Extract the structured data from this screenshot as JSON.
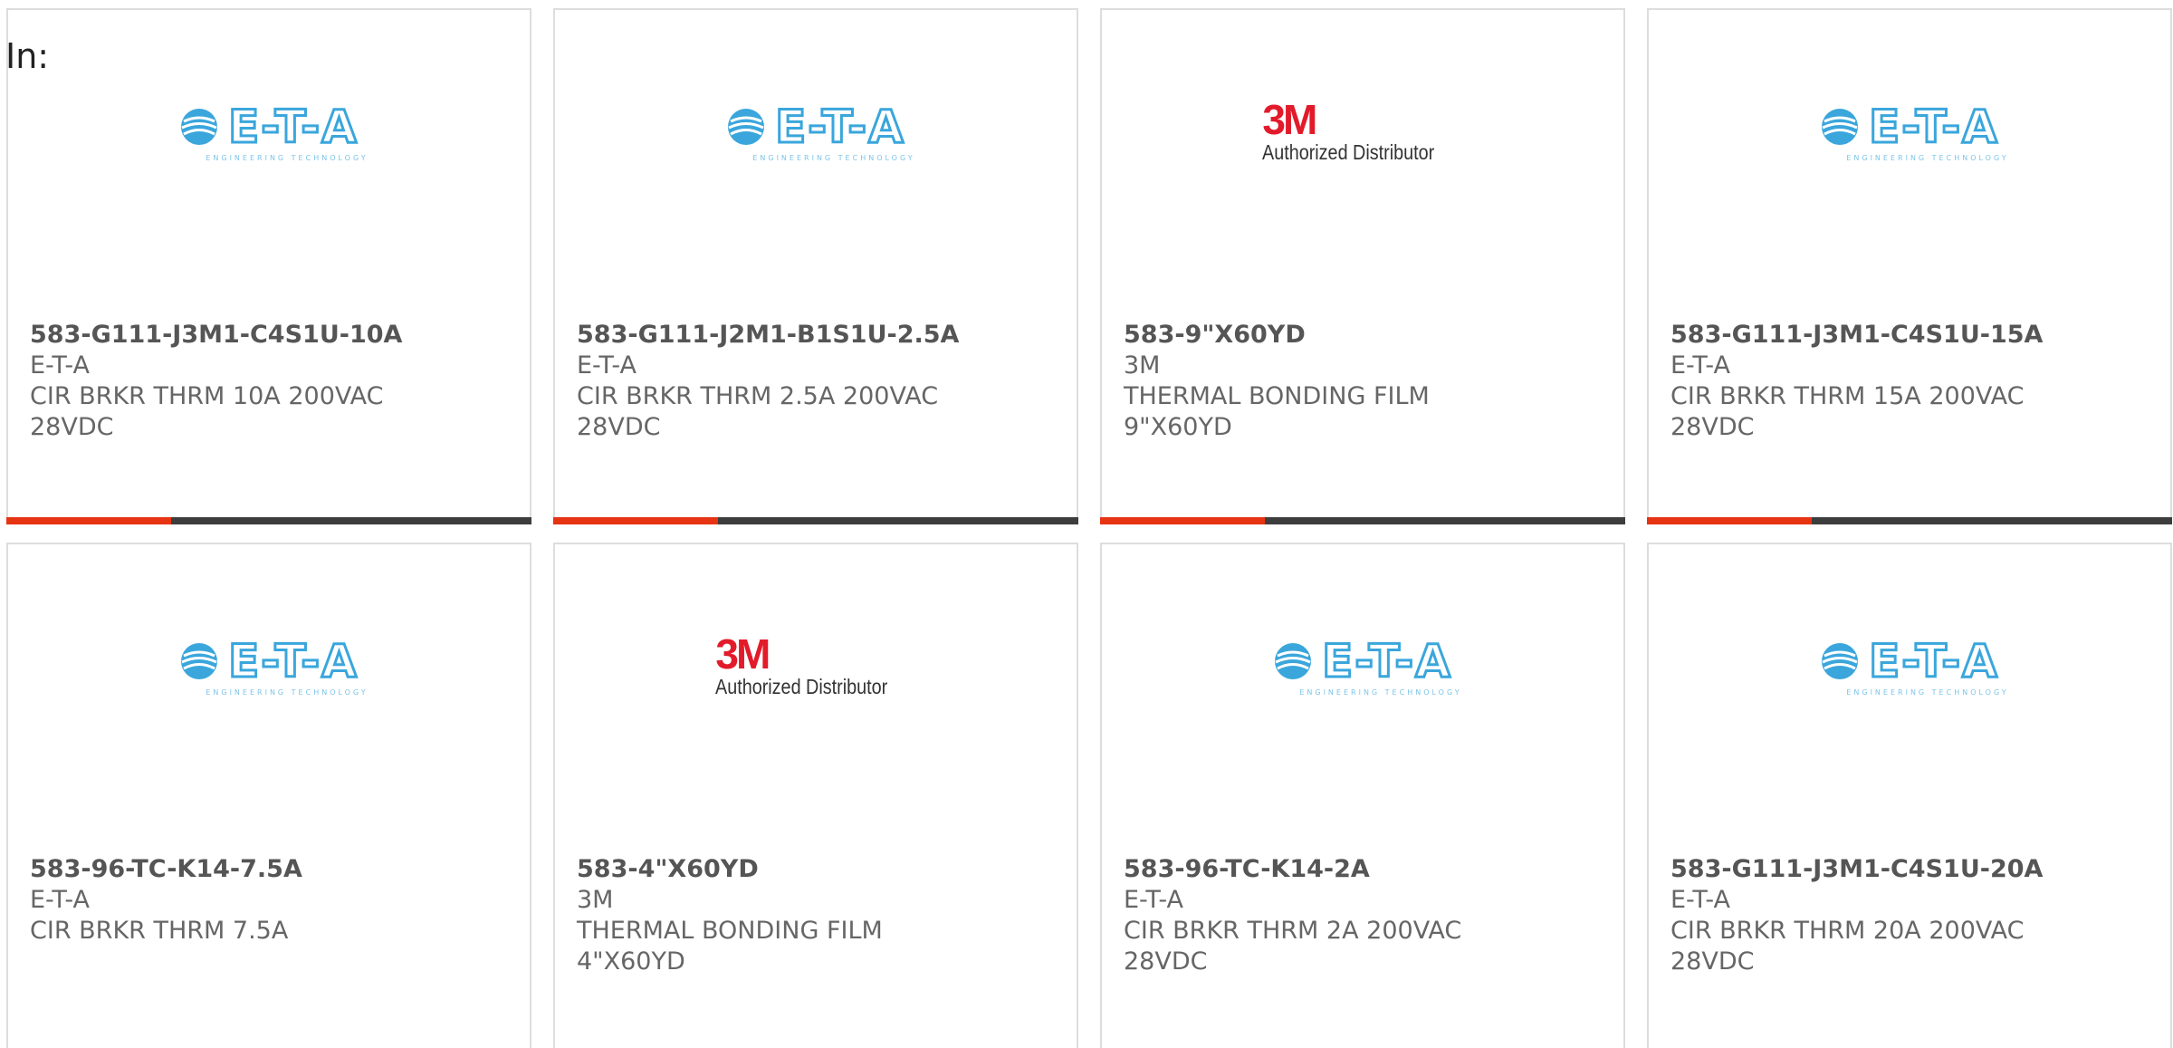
{
  "filter": {
    "label": "In:"
  },
  "brands": {
    "eta": {
      "name": "E-T-A",
      "tagline": "ENGINEERING TECHNOLOGY",
      "color": "#3aa6dc"
    },
    "mmm": {
      "name": "3M",
      "tagline": "Authorized Distributor",
      "color": "#e21b2b"
    }
  },
  "colors": {
    "accent": "#e63312",
    "bar": "#3d3d3d",
    "border": "#dddddd"
  },
  "products": [
    {
      "part_number": "583-G111-J3M1-C4S1U-10A",
      "manufacturer": "E-T-A",
      "desc_line1": "CIR BRKR THRM 10A 200VAC",
      "desc_line2": "28VDC",
      "logo": "eta"
    },
    {
      "part_number": "583-G111-J2M1-B1S1U-2.5A",
      "manufacturer": "E-T-A",
      "desc_line1": "CIR BRKR THRM 2.5A 200VAC",
      "desc_line2": "28VDC",
      "logo": "eta"
    },
    {
      "part_number": "583-9\"X60YD",
      "manufacturer": "3M",
      "desc_line1": "THERMAL BONDING FILM",
      "desc_line2": "9\"X60YD",
      "logo": "mmm"
    },
    {
      "part_number": "583-G111-J3M1-C4S1U-15A",
      "manufacturer": "E-T-A",
      "desc_line1": "CIR BRKR THRM 15A 200VAC",
      "desc_line2": "28VDC",
      "logo": "eta"
    },
    {
      "part_number": "583-96-TC-K14-7.5A",
      "manufacturer": "E-T-A",
      "desc_line1": "CIR BRKR THRM 7.5A",
      "desc_line2": "",
      "logo": "eta"
    },
    {
      "part_number": "583-4\"X60YD",
      "manufacturer": "3M",
      "desc_line1": "THERMAL BONDING FILM",
      "desc_line2": "4\"X60YD",
      "logo": "mmm"
    },
    {
      "part_number": "583-96-TC-K14-2A",
      "manufacturer": "E-T-A",
      "desc_line1": "CIR BRKR THRM 2A 200VAC",
      "desc_line2": "28VDC",
      "logo": "eta"
    },
    {
      "part_number": "583-G111-J3M1-C4S1U-20A",
      "manufacturer": "E-T-A",
      "desc_line1": "CIR BRKR THRM 20A 200VAC",
      "desc_line2": "28VDC",
      "logo": "eta"
    }
  ]
}
